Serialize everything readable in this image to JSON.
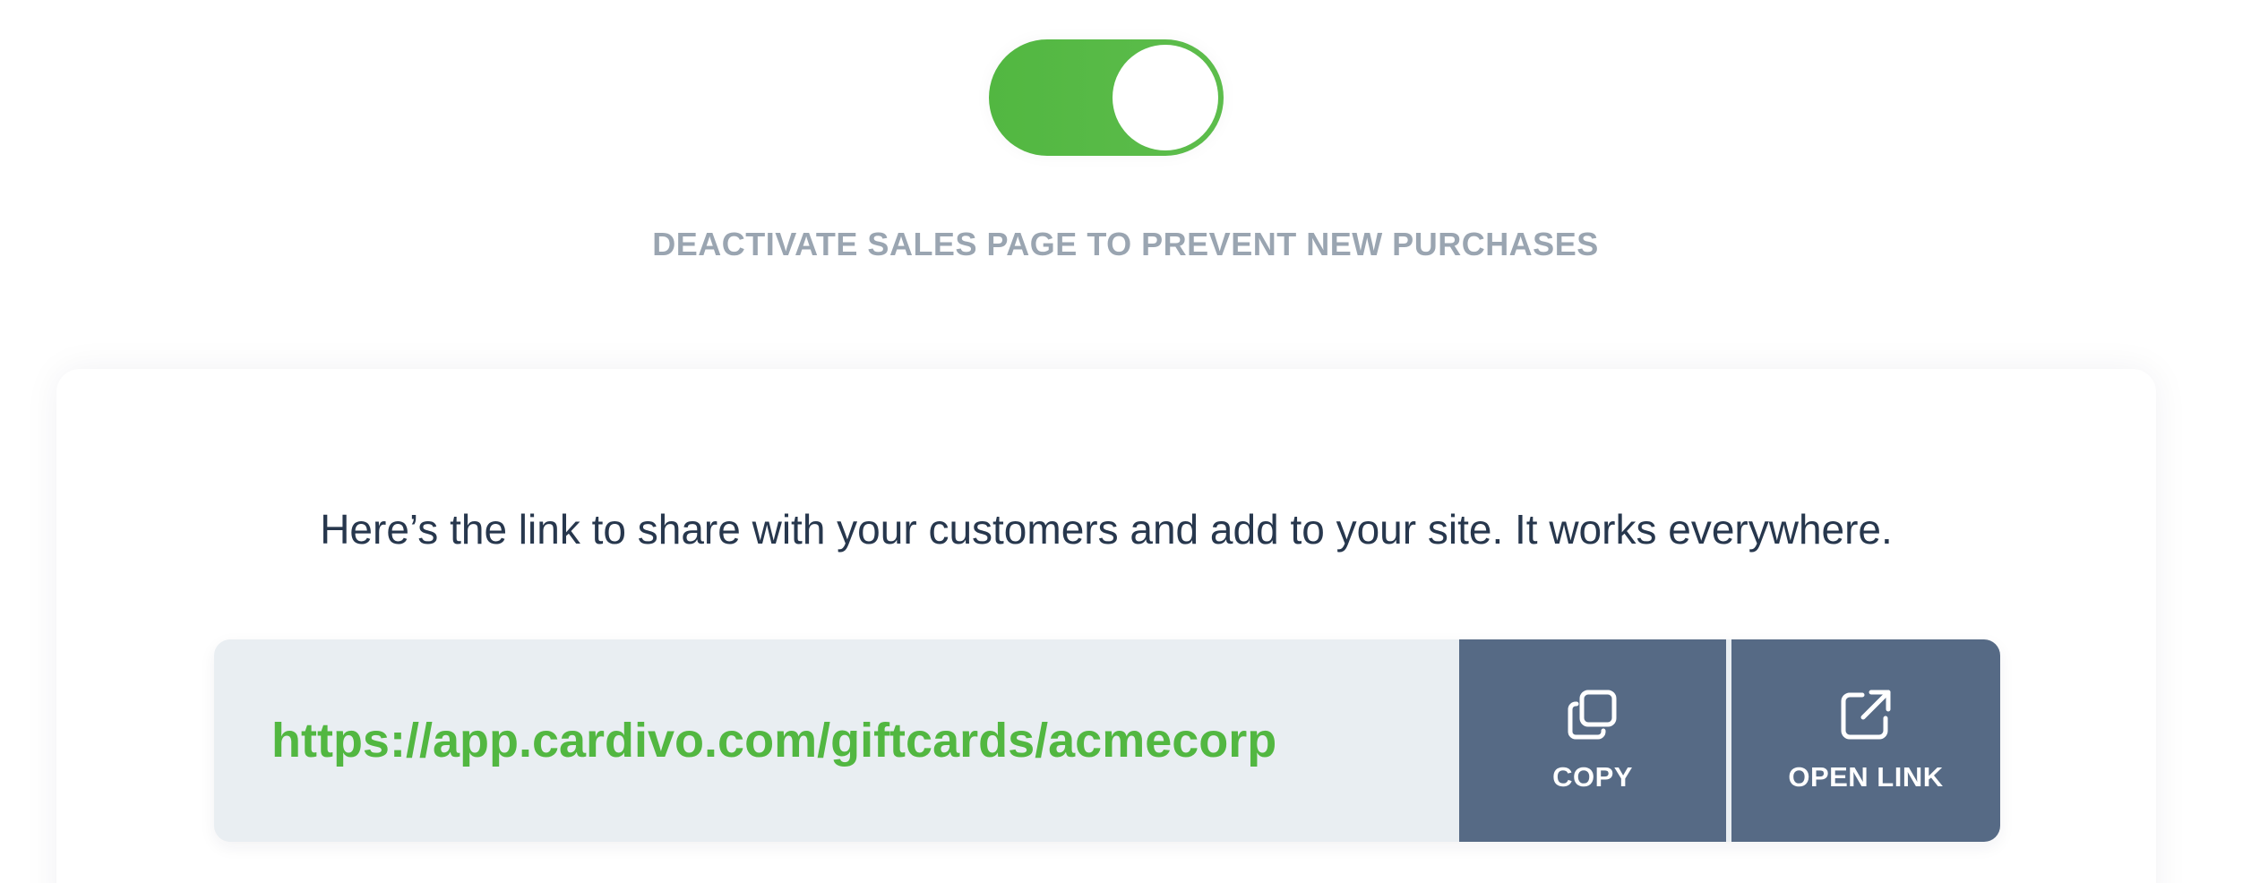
{
  "toggle": {
    "state": "on",
    "color": "#52b741"
  },
  "deactivate_label": "DEACTIVATE SALES PAGE TO PREVENT NEW PURCHASES",
  "share_card": {
    "heading": "Here’s the link to share with your customers and add to your site. It works everywhere.",
    "link_url": "https://app.cardivo.com/giftcards/acmecorp",
    "copy_button": {
      "label": "COPY",
      "icon": "copy-icon"
    },
    "open_button": {
      "label": "OPEN LINK",
      "icon": "external-link-icon"
    }
  },
  "colors": {
    "accent_green": "#52b741",
    "button_slate": "#566a85",
    "heading_text": "#27374d",
    "muted_label": "#9aa5b1",
    "link_bg": "#e9eef2"
  }
}
